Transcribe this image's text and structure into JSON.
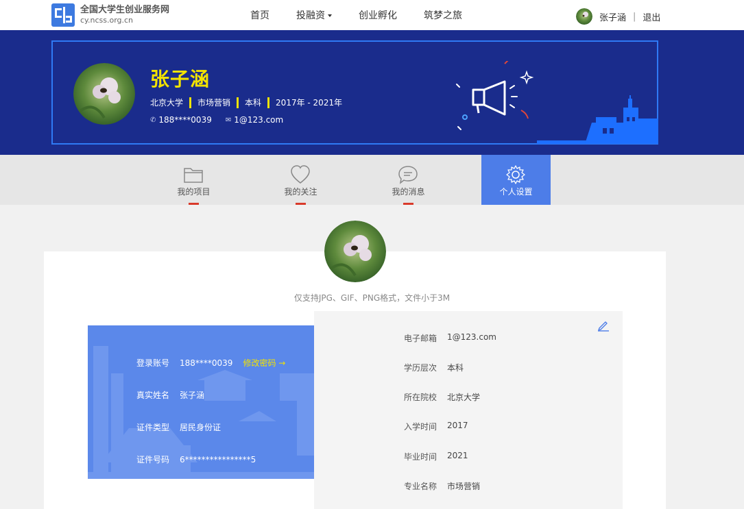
{
  "site": {
    "title": "全国大学生创业服务网",
    "url": "cy.ncss.org.cn"
  },
  "nav": {
    "items": [
      "首页",
      "投融资",
      "创业孵化",
      "筑梦之旅"
    ]
  },
  "user": {
    "name": "张子涵",
    "separator": "|",
    "logout": "退出"
  },
  "profile": {
    "name": "张子涵",
    "school": "北京大学",
    "major": "市场营销",
    "degree": "本科",
    "years": "2017年 - 2021年",
    "phone": "188****0039",
    "email": "1@123.com"
  },
  "tabs": [
    {
      "label": "我的项目",
      "icon": "folder-icon"
    },
    {
      "label": "我的关注",
      "icon": "heart-icon"
    },
    {
      "label": "我的消息",
      "icon": "message-icon"
    },
    {
      "label": "个人设置",
      "icon": "gear-icon"
    }
  ],
  "settings": {
    "avatar_hint": "仅支持JPG、GIF、PNG格式，文件小于3M",
    "account": {
      "login_label": "登录账号",
      "login_value": "188****0039",
      "change_password": "修改密码 →",
      "realname_label": "真实姓名",
      "realname_value": "张子涵",
      "idtype_label": "证件类型",
      "idtype_value": "居民身份证",
      "idno_label": "证件号码",
      "idno_value": "6****************5"
    },
    "info": [
      {
        "label": "电子邮箱",
        "value": "1@123.com"
      },
      {
        "label": "学历层次",
        "value": "本科"
      },
      {
        "label": "所在院校",
        "value": "北京大学"
      },
      {
        "label": "入学时间",
        "value": "2017"
      },
      {
        "label": "毕业时间",
        "value": "2021"
      },
      {
        "label": "专业名称",
        "value": "市场营销"
      }
    ]
  },
  "colors": {
    "banner": "#1a2c8c",
    "accent": "#4d7de8",
    "highlight": "#f3e300",
    "tab_mark": "#d93a2b"
  }
}
